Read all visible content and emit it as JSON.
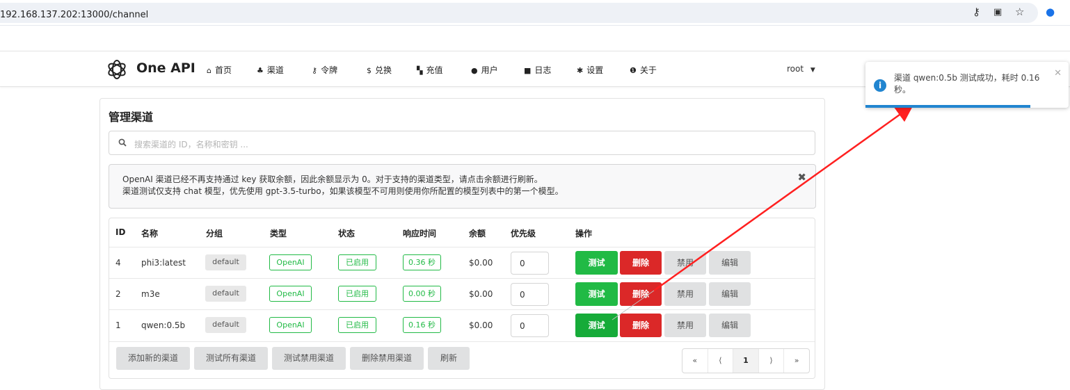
{
  "browser": {
    "url": "192.168.137.202:13000/channel"
  },
  "header": {
    "app_name": "One API",
    "nav": [
      {
        "icon": "home-icon",
        "glyph": "⌂",
        "label": "首页"
      },
      {
        "icon": "sitemap-icon",
        "glyph": "♣",
        "label": "渠道"
      },
      {
        "icon": "key-icon",
        "glyph": "⚷",
        "label": "令牌"
      },
      {
        "icon": "dollar-icon",
        "glyph": "$",
        "label": "兑换"
      },
      {
        "icon": "cart-icon",
        "glyph": "▚",
        "label": "充值"
      },
      {
        "icon": "user-icon",
        "glyph": "●",
        "label": "用户"
      },
      {
        "icon": "book-icon",
        "glyph": "■",
        "label": "日志"
      },
      {
        "icon": "gear-icon",
        "glyph": "✱",
        "label": "设置"
      },
      {
        "icon": "info-icon",
        "glyph": "❶",
        "label": "关于"
      }
    ],
    "user": "root"
  },
  "page": {
    "title": "管理渠道",
    "search_placeholder": "搜索渠道的 ID，名称和密钥 ...",
    "message_line1": "OpenAI 渠道已经不再支持通过 key 获取余额，因此余额显示为 0。对于支持的渠道类型，请点击余额进行刷新。",
    "message_line2": "渠道测试仅支持 chat 模型，优先使用 gpt-3.5-turbo，如果该模型不可用则使用你所配置的模型列表中的第一个模型。"
  },
  "table": {
    "headers": [
      "ID",
      "名称",
      "分组",
      "类型",
      "状态",
      "响应时间",
      "余额",
      "优先级",
      "操作"
    ],
    "rows": [
      {
        "id": "4",
        "name": "phi3:latest",
        "group": "default",
        "type": "OpenAI",
        "status": "已启用",
        "response": "0.36 秒",
        "balance": "$0.00",
        "priority": "0"
      },
      {
        "id": "2",
        "name": "m3e",
        "group": "default",
        "type": "OpenAI",
        "status": "已启用",
        "response": "0.00 秒",
        "balance": "$0.00",
        "priority": "0"
      },
      {
        "id": "1",
        "name": "qwen:0.5b",
        "group": "default",
        "type": "OpenAI",
        "status": "已启用",
        "response": "0.16 秒",
        "balance": "$0.00",
        "priority": "0"
      }
    ],
    "actions": {
      "test": "测试",
      "delete": "删除",
      "disable": "禁用",
      "edit": "编辑"
    },
    "footer_buttons": [
      "添加新的渠道",
      "测试所有渠道",
      "测试禁用渠道",
      "删除禁用渠道",
      "刷新"
    ],
    "pager": [
      "«",
      "⟨",
      "1",
      "⟩",
      "»"
    ]
  },
  "toast": {
    "message": "渠道 qwen:0.5b 测试成功，耗时 0.16 秒。",
    "progress_percent": 81
  },
  "colors": {
    "green": "#21ba45",
    "red": "#db2828",
    "blue": "#2185d0",
    "arrow": "#ff2020"
  }
}
